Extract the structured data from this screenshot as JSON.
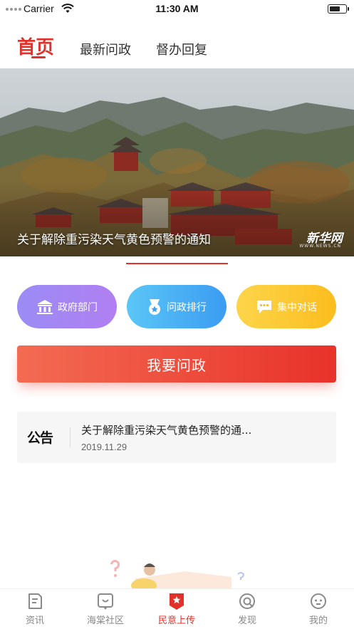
{
  "status_bar": {
    "carrier": "Carrier",
    "time": "11:30 AM",
    "battery_level": 0.7
  },
  "tabs": [
    {
      "label": "首页",
      "active": true
    },
    {
      "label": "最新问政",
      "active": false
    },
    {
      "label": "督办回复",
      "active": false
    }
  ],
  "banner": {
    "caption": "关于解除重污染天气黄色预警的通知",
    "watermark": "新华网",
    "watermark_sub": "WWW.NEWS.CN"
  },
  "quick_actions": [
    {
      "label": "政府部门",
      "icon": "government-building-icon",
      "color": "#a585f3"
    },
    {
      "label": "问政排行",
      "icon": "medal-star-icon",
      "color": "#4aaef4"
    },
    {
      "label": "集中对话",
      "icon": "chat-bubble-icon",
      "color": "#fcc630"
    }
  ],
  "cta": {
    "label": "我要问政"
  },
  "notice": {
    "badge": "公告",
    "title": "关于解除重污染天气黄色预警的通...",
    "date": "2019.11.29"
  },
  "tab_bar": [
    {
      "label": "资讯",
      "icon": "news-document-icon",
      "active": false
    },
    {
      "label": "海棠社区",
      "icon": "community-chat-icon",
      "active": false
    },
    {
      "label": "民意上传",
      "icon": "upload-star-icon",
      "active": true
    },
    {
      "label": "发现",
      "icon": "discover-compass-icon",
      "active": false
    },
    {
      "label": "我的",
      "icon": "profile-face-icon",
      "active": false
    }
  ],
  "colors": {
    "accent": "#e0322b",
    "tab_inactive": "#888888"
  }
}
